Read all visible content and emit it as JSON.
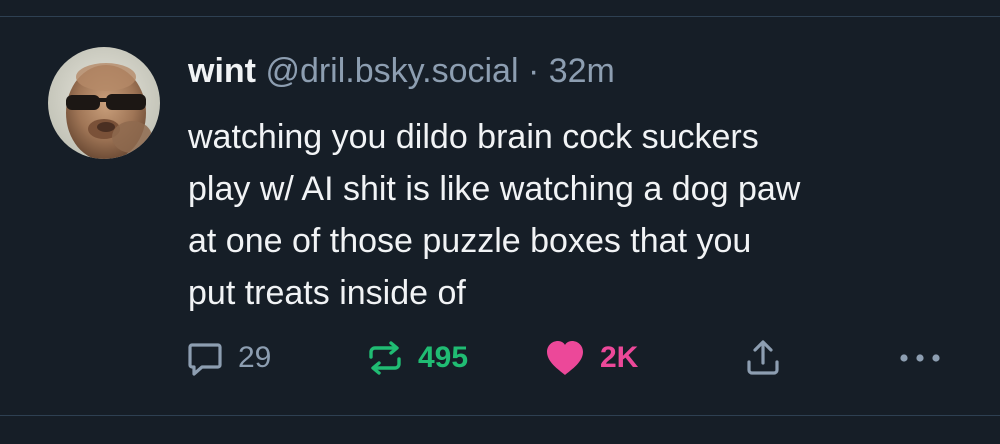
{
  "post": {
    "author": {
      "display_name": "wint",
      "handle": "@dril.bsky.social"
    },
    "separator": "·",
    "timestamp": "32m",
    "text": "watching you dildo brain cock suckers\nplay w/ AI shit is like watching a dog paw\nat one of those puzzle boxes that you\nput treats inside of",
    "stats": {
      "replies": "29",
      "reposts": "495",
      "likes": "2K"
    },
    "state": {
      "reposted": true,
      "liked": true
    }
  },
  "icons": {
    "reply": "speech-bubble-icon",
    "repost": "repost-arrows-icon",
    "like": "heart-icon",
    "share": "share-icon",
    "more": "more-dots-icon"
  },
  "colors": {
    "background": "#161e27",
    "divider": "#2e4052",
    "text_primary": "#f1f3f5",
    "text_secondary": "#8d9eb1",
    "repost_active": "#20bc73",
    "like_active": "#ec4899"
  }
}
